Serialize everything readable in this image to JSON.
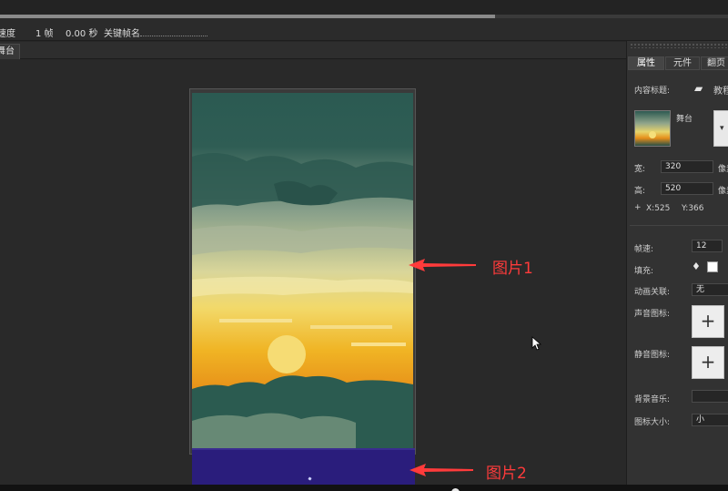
{
  "toolbar": {
    "progress": 0.68
  },
  "timeline": {
    "speed_label": "速度",
    "frames": "1 帧",
    "seconds": "0.00 秒",
    "keyframe_label": "关键帧名"
  },
  "tabs": {
    "stage": "舞台"
  },
  "annotations": {
    "image1": "图片1",
    "image2": "图片2"
  },
  "panel": {
    "tabs": [
      "属性",
      "元件",
      "翻页"
    ],
    "content_title_label": "内容标题:",
    "content_title_value": "教程",
    "stage_name": "舞台",
    "width_label": "宽:",
    "width_value": "320",
    "width_unit": "像素",
    "height_label": "高:",
    "height_value": "520",
    "height_unit": "像素",
    "x_readout": "X:525",
    "y_readout": "Y:366",
    "fps_label": "帧速:",
    "fps_value": "12",
    "fill_label": "填充:",
    "anim_link_label": "动画关联:",
    "anim_link_value": "无",
    "sound_icon_label": "声音图标:",
    "mute_icon_label": "静音图标:",
    "bgm_label": "背景音乐:",
    "icon_size_label": "图标大小:",
    "icon_size_value": "小",
    "add_symbol": "+"
  },
  "colors": {
    "arrow": "#ff3b3b",
    "image2_fill": "#2a1d7c",
    "sky_top": "#2b5a52",
    "sun": "#f6dc74"
  }
}
